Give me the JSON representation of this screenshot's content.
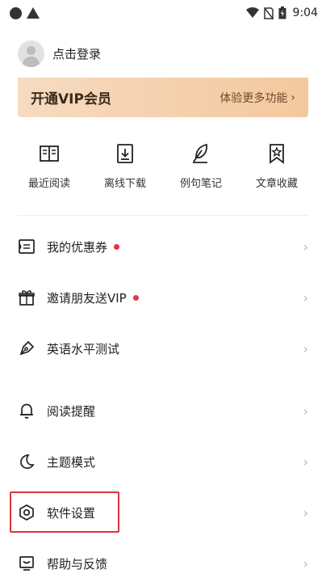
{
  "status_bar": {
    "time": "9:04"
  },
  "user": {
    "login_text": "点击登录"
  },
  "vip": {
    "title": "开通VIP会员",
    "subtitle": "体验更多功能"
  },
  "quick_actions": [
    {
      "label": "最近阅读",
      "icon": "book-open-icon"
    },
    {
      "label": "离线下载",
      "icon": "download-icon"
    },
    {
      "label": "例句笔记",
      "icon": "feather-pen-icon"
    },
    {
      "label": "文章收藏",
      "icon": "bookmark-star-icon"
    }
  ],
  "menu": [
    {
      "label": "我的优惠券",
      "icon": "coupon-icon",
      "has_dot": true
    },
    {
      "label": "邀请朋友送VIP",
      "icon": "gift-icon",
      "has_dot": true
    },
    {
      "label": "英语水平测试",
      "icon": "pen-nib-icon",
      "has_dot": false
    },
    {
      "label": "阅读提醒",
      "icon": "bell-icon",
      "has_dot": false
    },
    {
      "label": "主题模式",
      "icon": "moon-icon",
      "has_dot": false
    },
    {
      "label": "软件设置",
      "icon": "settings-hexagon-icon",
      "has_dot": false
    },
    {
      "label": "帮助与反馈",
      "icon": "feedback-icon",
      "has_dot": false
    }
  ],
  "chevron": "›",
  "colors": {
    "accent_dot": "#e8334a",
    "vip_gradient_start": "#f6dbc2",
    "vip_gradient_end": "#f4c89d",
    "highlight": "#d9333f"
  }
}
